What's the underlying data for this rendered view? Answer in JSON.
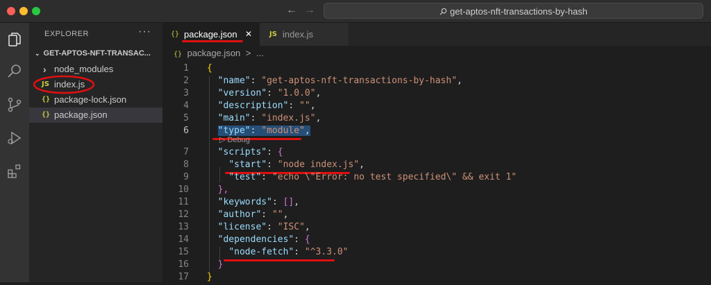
{
  "window": {
    "search_text": "get-aptos-nft-transactions-by-hash"
  },
  "colors": {
    "accent_red": "#e01010",
    "traffic_red": "#ff5f57",
    "traffic_yellow": "#febc2e",
    "traffic_green": "#28c840"
  },
  "activity_bar": {
    "icons": [
      "explorer-icon",
      "search-icon",
      "source-control-icon",
      "run-debug-icon",
      "extensions-icon"
    ]
  },
  "sidebar": {
    "title": "EXPLORER",
    "more": "···",
    "folder_name": "GET-APTOS-NFT-TRANSAC...",
    "items": [
      {
        "label": "node_modules",
        "icon": "›",
        "kind": "folder"
      },
      {
        "label": "index.js",
        "icon": "JS",
        "kind": "js"
      },
      {
        "label": "package-lock.json",
        "icon": "{}",
        "kind": "json"
      },
      {
        "label": "package.json",
        "icon": "{}",
        "kind": "json"
      }
    ]
  },
  "tabs": [
    {
      "label": "package.json",
      "icon": "{}",
      "close": "✕"
    },
    {
      "label": "index.js",
      "icon": "JS"
    }
  ],
  "breadcrumb": {
    "icon": "{}",
    "file": "package.json",
    "sep": ">",
    "rest": "..."
  },
  "codelens": "▷ Debug",
  "code_lines": [
    "1",
    "2",
    "3",
    "4",
    "5",
    "6",
    "7",
    "8",
    "9",
    "10",
    "11",
    "12",
    "13",
    "14",
    "15",
    "16",
    "17"
  ],
  "code": {
    "l1": "{",
    "l2k": "\"name\"",
    "l2v": "\"get-aptos-nft-transactions-by-hash\"",
    "l3k": "\"version\"",
    "l3v": "\"1.0.0\"",
    "l4k": "\"description\"",
    "l4v": "\"\"",
    "l5k": "\"main\"",
    "l5v": "\"index.js\"",
    "l6k": "\"type\"",
    "l6v": "\"module\"",
    "l7k": "\"scripts\"",
    "l7b": "{",
    "l8k": "\"start\"",
    "l8v": "\"node index.js\"",
    "l9k": "\"test\"",
    "l9v": "\"echo \\\"Error: no test specified\\\" && exit 1\"",
    "l10": "},",
    "l11k": "\"keywords\"",
    "l11v": "[]",
    "l12k": "\"author\"",
    "l12v": "\"\"",
    "l13k": "\"license\"",
    "l13v": "\"ISC\"",
    "l14k": "\"dependencies\"",
    "l14b": "{",
    "l15k": "\"node-fetch\"",
    "l15v": "\"^3.3.0\"",
    "l16": "}",
    "l17": "}"
  }
}
